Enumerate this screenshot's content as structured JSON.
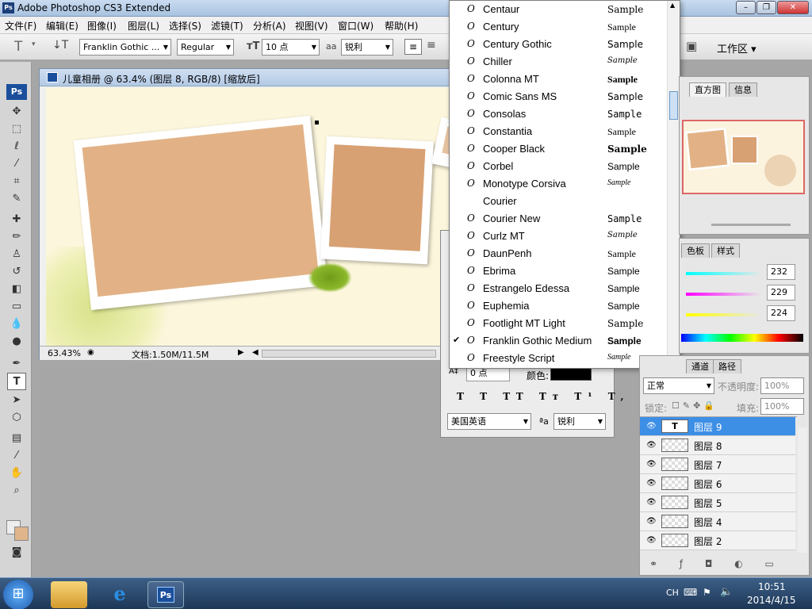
{
  "app": {
    "title": "Adobe Photoshop CS3 Extended",
    "logo": "Ps"
  },
  "window_controls": {
    "minimize": "–",
    "restore": "❐",
    "close": "✕"
  },
  "menu": [
    "文件(F)",
    "编辑(E)",
    "图像(I)",
    "图层(L)",
    "选择(S)",
    "滤镜(T)",
    "分析(A)",
    "视图(V)",
    "窗口(W)",
    "帮助(H)"
  ],
  "options": {
    "font_family": "Franklin Gothic ...",
    "font_style": "Regular",
    "font_size": "10 点",
    "anti_alias": "锐利",
    "workspace": "工作区 ▾"
  },
  "document": {
    "title": "儿童相册 @ 63.4% (图层 8, RGB/8) [缩放后]",
    "zoom": "63.43%",
    "doc_info": "文档:1.50M/11.5M"
  },
  "font_list": {
    "items": [
      {
        "name": "Centaur",
        "sample": "Sample",
        "checked": false
      },
      {
        "name": "Century",
        "sample": "Sample",
        "checked": false
      },
      {
        "name": "Century Gothic",
        "sample": "Sample",
        "checked": false
      },
      {
        "name": "Chiller",
        "sample": "Sample",
        "checked": false
      },
      {
        "name": "Colonna MT",
        "sample": "Sample",
        "checked": false
      },
      {
        "name": "Comic Sans MS",
        "sample": "Sample",
        "checked": false
      },
      {
        "name": "Consolas",
        "sample": "Sample",
        "checked": false
      },
      {
        "name": "Constantia",
        "sample": "Sample",
        "checked": false
      },
      {
        "name": "Cooper Black",
        "sample": "Sample",
        "checked": false
      },
      {
        "name": "Corbel",
        "sample": "Sample",
        "checked": false
      },
      {
        "name": "Monotype Corsiva",
        "sample": "Sample",
        "checked": false
      },
      {
        "name": "Courier",
        "sample": "",
        "checked": false
      },
      {
        "name": "Courier New",
        "sample": "Sample",
        "checked": false
      },
      {
        "name": "Curlz MT",
        "sample": "Sample",
        "checked": false
      },
      {
        "name": "DaunPenh",
        "sample": "Sample",
        "checked": false
      },
      {
        "name": "Ebrima",
        "sample": "Sample",
        "checked": false
      },
      {
        "name": "Estrangelo Edessa",
        "sample": "Sample",
        "checked": false
      },
      {
        "name": "Euphemia",
        "sample": "Sample",
        "checked": false
      },
      {
        "name": "Footlight MT Light",
        "sample": "Sample",
        "checked": false
      },
      {
        "name": "Franklin Gothic Medium",
        "sample": "Sample",
        "checked": true
      },
      {
        "name": "Freestyle Script",
        "sample": "Sample",
        "checked": false
      }
    ]
  },
  "character_panel": {
    "tracking": "0 点",
    "color_label": "颜色:",
    "language": "美国英语",
    "anti_alias": "锐利"
  },
  "navigator": {
    "tabs": [
      "直方图",
      "信息"
    ]
  },
  "color_panel": {
    "tabs": [
      "色板",
      "样式"
    ],
    "values": [
      "232",
      "229",
      "224"
    ]
  },
  "layers_panel": {
    "tabs": [
      "通道",
      "路径"
    ],
    "blend_mode": "正常",
    "opacity_label": "不透明度:",
    "opacity": "100%",
    "lock_label": "锁定:",
    "fill_label": "填充:",
    "fill": "100%",
    "layers": [
      {
        "name": "图层 9",
        "selected": true,
        "type": "text"
      },
      {
        "name": "图层 8",
        "selected": false,
        "type": "image"
      },
      {
        "name": "图层 7",
        "selected": false,
        "type": "image"
      },
      {
        "name": "图层 6",
        "selected": false,
        "type": "image"
      },
      {
        "name": "图层 5",
        "selected": false,
        "type": "image"
      },
      {
        "name": "图层 4",
        "selected": false,
        "type": "image"
      },
      {
        "name": "图层 2",
        "selected": false,
        "type": "image"
      }
    ]
  },
  "taskbar": {
    "start": "⊞",
    "apps": [
      "explorer",
      "internet-explorer",
      "photoshop"
    ],
    "ps_label": "Ps",
    "ime": "CH",
    "time": "10:51",
    "date": "2014/4/15"
  }
}
